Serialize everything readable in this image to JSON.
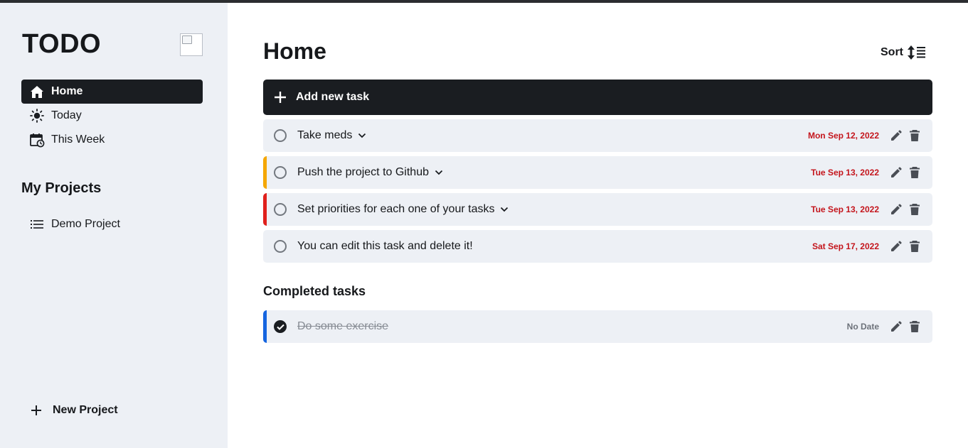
{
  "app": {
    "logo": "TODO"
  },
  "sidebar": {
    "nav": [
      {
        "label": "Home",
        "icon": "home-icon",
        "active": true
      },
      {
        "label": "Today",
        "icon": "sun-icon",
        "active": false
      },
      {
        "label": "This Week",
        "icon": "calendar-week-icon",
        "active": false
      }
    ],
    "projects_title": "My Projects",
    "projects": [
      {
        "label": "Demo Project",
        "icon": "list-icon"
      }
    ],
    "new_project_label": "New Project"
  },
  "main": {
    "title": "Home",
    "sort_label": "Sort",
    "add_task_label": "Add new task",
    "tasks": [
      {
        "title": "Take meds",
        "date": "Mon Sep 12, 2022",
        "priority_color": "",
        "expandable": true
      },
      {
        "title": "Push the project to Github",
        "date": "Tue Sep 13, 2022",
        "priority_color": "#f5a700",
        "expandable": true
      },
      {
        "title": "Set priorities for each one of your tasks",
        "date": "Tue Sep 13, 2022",
        "priority_color": "#e0201c",
        "expandable": true
      },
      {
        "title": "You can edit this task and delete it!",
        "date": "Sat Sep 17, 2022",
        "priority_color": "",
        "expandable": false
      }
    ],
    "completed_title": "Completed tasks",
    "completed_tasks": [
      {
        "title": "Do some exercise",
        "date": "No Date",
        "priority_color": "#1565e0"
      }
    ]
  },
  "colors": {
    "sidebar_bg": "#edf0f5",
    "dark": "#1a1d21",
    "date_red": "#c4151c",
    "priority_medium": "#f5a700",
    "priority_high": "#e0201c",
    "priority_low": "#1565e0"
  }
}
